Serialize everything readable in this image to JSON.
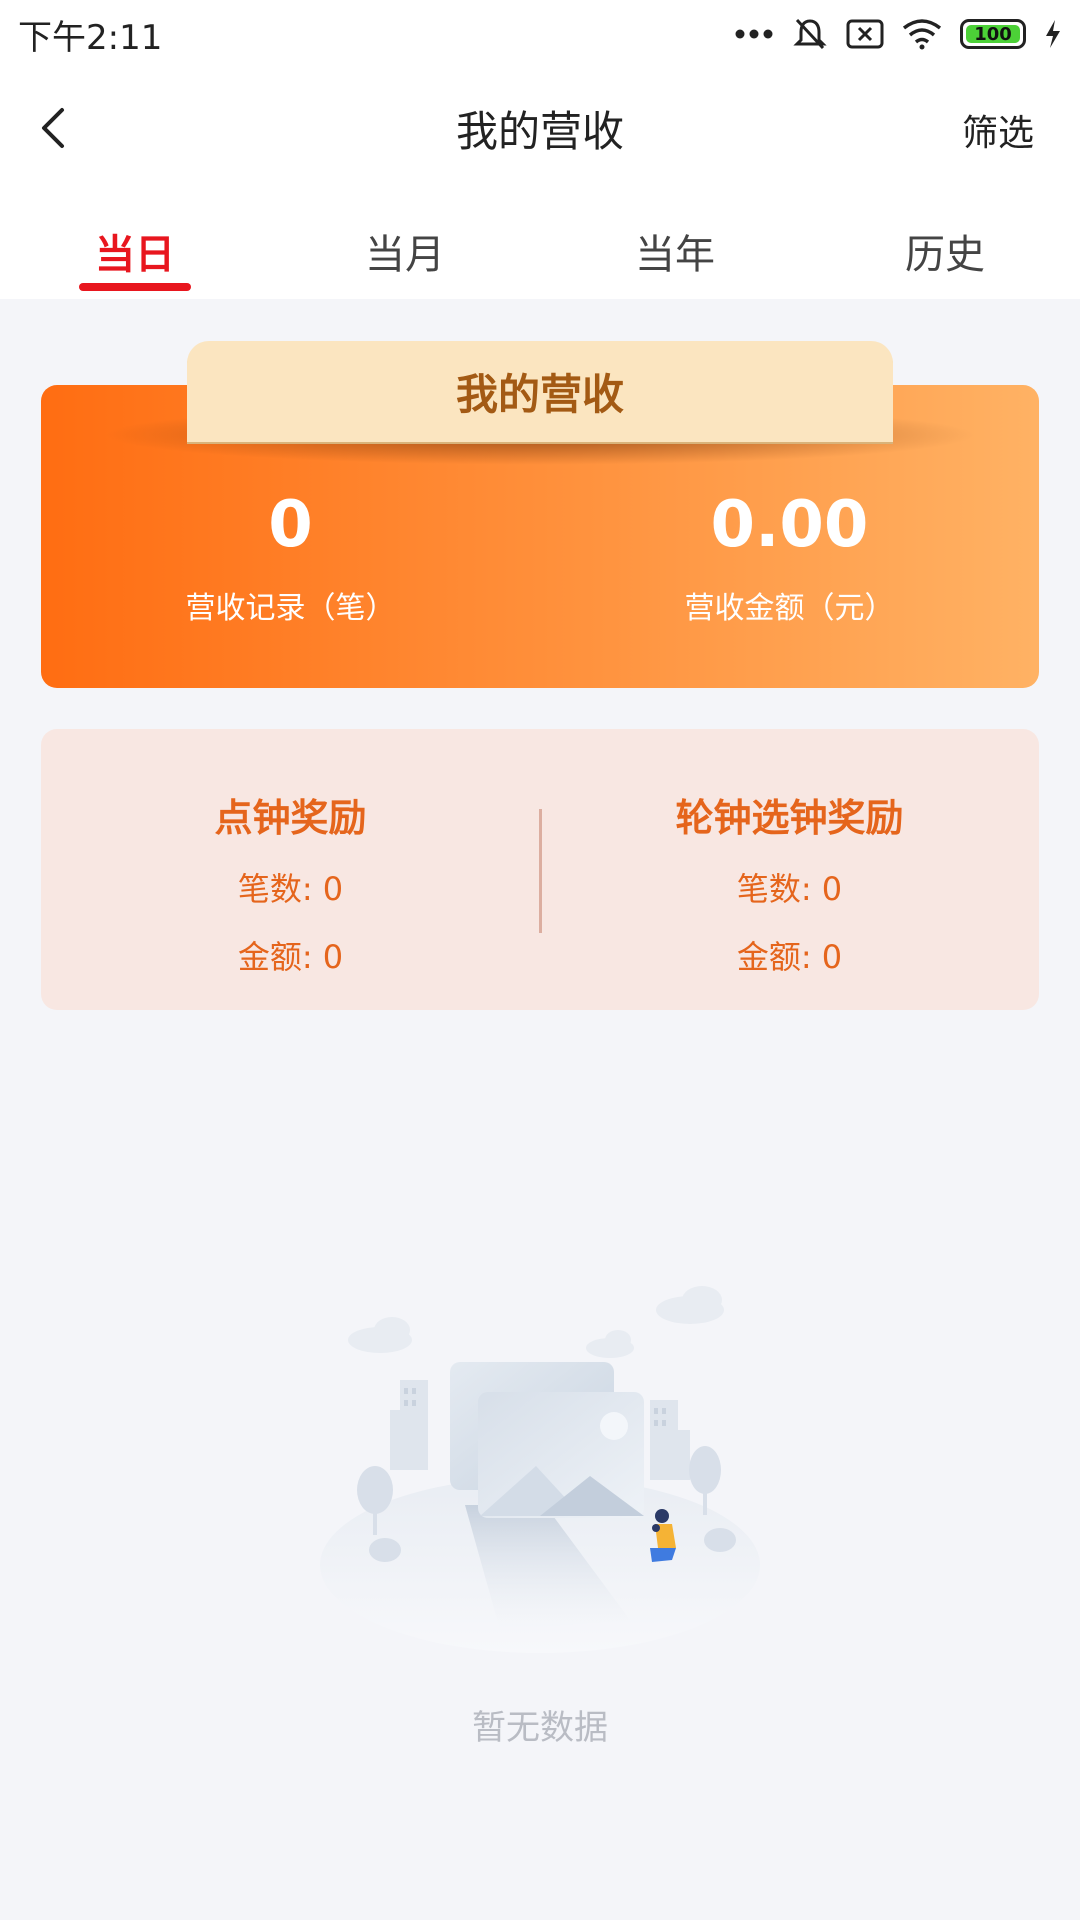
{
  "status_bar": {
    "time": "下午2:11",
    "battery": "100",
    "icons": [
      "more-dots-icon",
      "mute-bell-icon",
      "sim-x-icon",
      "wifi-icon",
      "battery-icon",
      "charging-icon"
    ]
  },
  "nav": {
    "title": "我的营收",
    "filter_label": "筛选",
    "back_icon": "chevron-left-icon"
  },
  "tabs": [
    {
      "label": "当日",
      "active": true
    },
    {
      "label": "当月",
      "active": false
    },
    {
      "label": "当年",
      "active": false
    },
    {
      "label": "历史",
      "active": false
    }
  ],
  "summary": {
    "header": "我的营收",
    "records_value": "0",
    "records_label": "营收记录（笔）",
    "amount_value": "0.00",
    "amount_label": "营收金额（元）"
  },
  "rewards": {
    "left": {
      "title": "点钟奖励",
      "count": "笔数: 0",
      "amount": "金额: 0"
    },
    "right": {
      "title": "轮钟选钟奖励",
      "count": "笔数: 0",
      "amount": "金额: 0"
    }
  },
  "empty_state": {
    "text": "暂无数据",
    "illustration": "empty-data-illustration"
  },
  "colors": {
    "accent_red": "#e8161e",
    "orange_start": "#ff6d12",
    "orange_end": "#ffb264",
    "reward_text": "#e5651c"
  }
}
